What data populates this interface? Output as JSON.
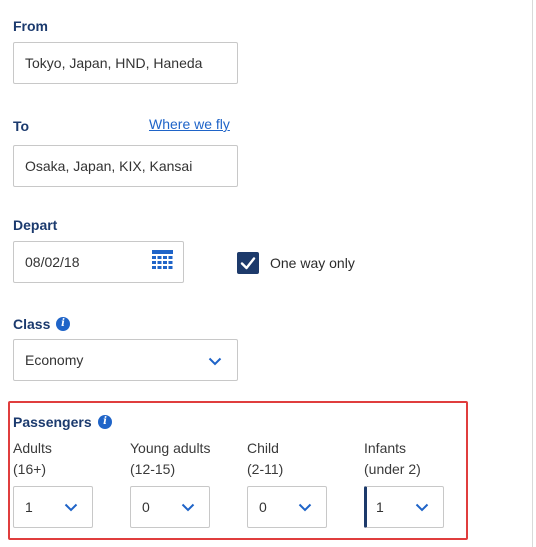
{
  "from": {
    "label": "From",
    "value": "Tokyo, Japan, HND, Haneda"
  },
  "to": {
    "label": "To",
    "link": "Where we fly",
    "value": "Osaka, Japan, KIX, Kansai"
  },
  "depart": {
    "label": "Depart",
    "value": "08/02/18",
    "one_way_label": "One way only",
    "one_way_checked": true
  },
  "class": {
    "label": "Class",
    "value": "Economy"
  },
  "passengers": {
    "label": "Passengers",
    "groups": [
      {
        "name": "Adults",
        "range": "(16+)",
        "value": "1"
      },
      {
        "name": "Young adults",
        "range": "(12-15)",
        "value": "0"
      },
      {
        "name": "Child",
        "range": "(2-11)",
        "value": "0"
      },
      {
        "name": "Infants",
        "range": "(under 2)",
        "value": "1"
      }
    ]
  },
  "colors": {
    "label_blue": "#1b3a6e",
    "link_blue": "#1f64c8",
    "highlight_red": "#e03d3d"
  }
}
